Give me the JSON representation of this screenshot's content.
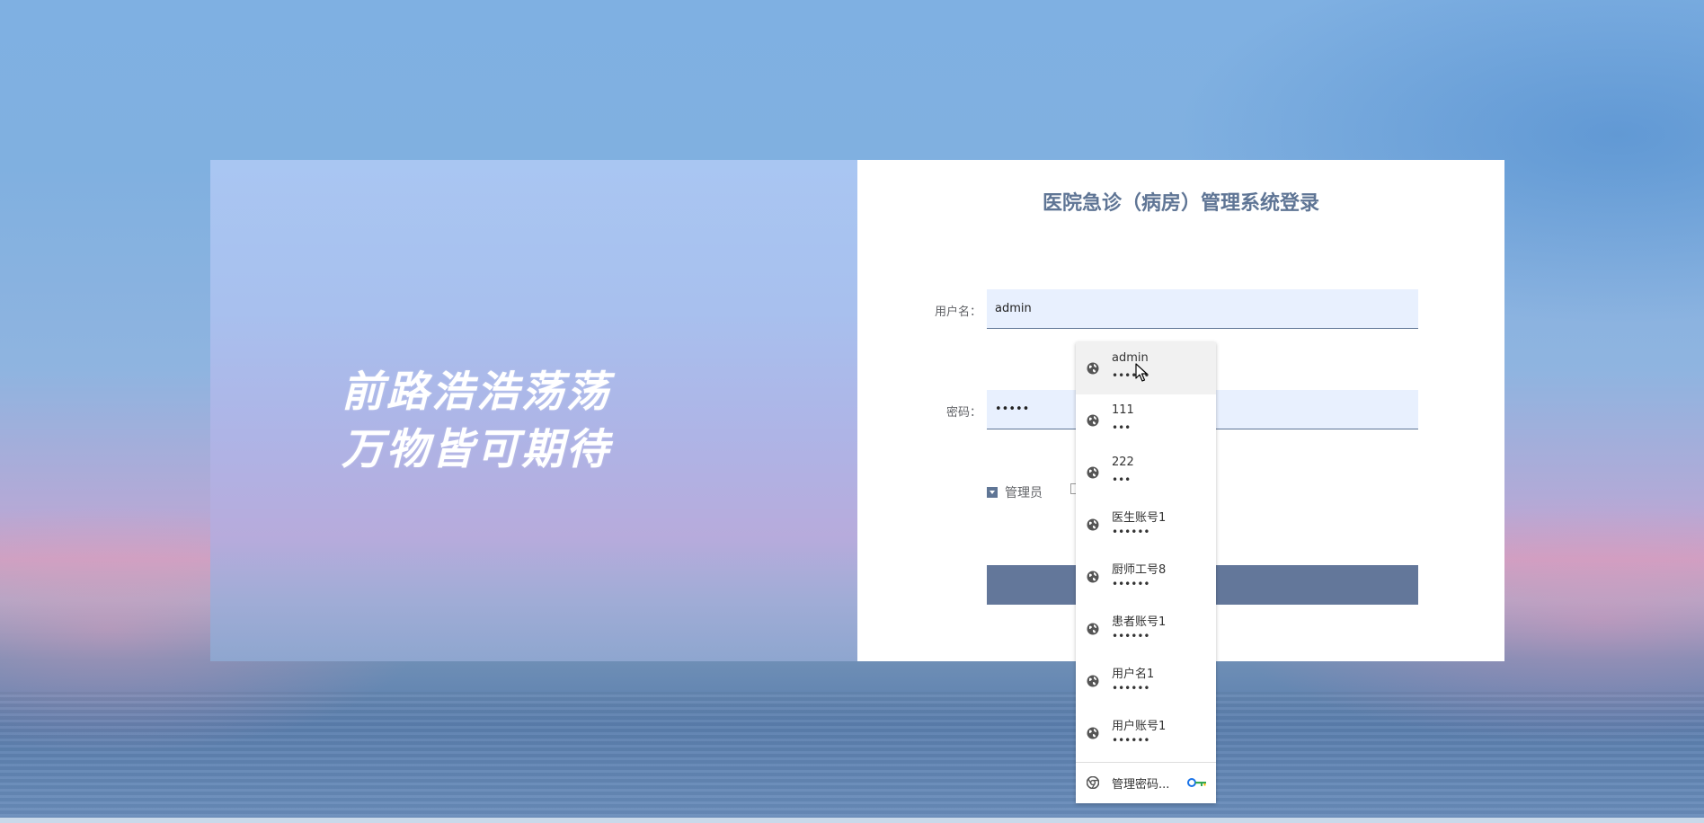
{
  "slogan": {
    "line1": "前路浩浩荡荡",
    "line2": "万物皆可期待"
  },
  "login": {
    "title": "医院急诊（病房）管理系统登录",
    "username_label": "用户名：",
    "username_value": "admin",
    "password_label": "密码：",
    "password_value": "•••••",
    "roles": [
      {
        "label": "管理员",
        "selected": true
      },
      {
        "label": "",
        "selected": false
      }
    ],
    "login_button_label": ""
  },
  "autofill": {
    "items": [
      {
        "username": "admin",
        "password": "••••••",
        "icon": "globe-icon"
      },
      {
        "username": "111",
        "password": "•••",
        "icon": "globe-icon"
      },
      {
        "username": "222",
        "password": "•••",
        "icon": "globe-icon"
      },
      {
        "username": "医生账号1",
        "password": "••••••",
        "icon": "globe-icon"
      },
      {
        "username": "厨师工号8",
        "password": "••••••",
        "icon": "globe-icon"
      },
      {
        "username": "患者账号1",
        "password": "••••••",
        "icon": "globe-icon"
      },
      {
        "username": "用户名1",
        "password": "••••••",
        "icon": "globe-icon"
      },
      {
        "username": "用户账号1",
        "password": "••••••",
        "icon": "globe-icon"
      }
    ],
    "manage_label": "管理密码...",
    "manage_icon": "chrome-icon",
    "key_icon": "key-icon"
  },
  "colors": {
    "accent": "#5f7595",
    "button": "#63779a",
    "field_bg": "#e8f0fe"
  }
}
